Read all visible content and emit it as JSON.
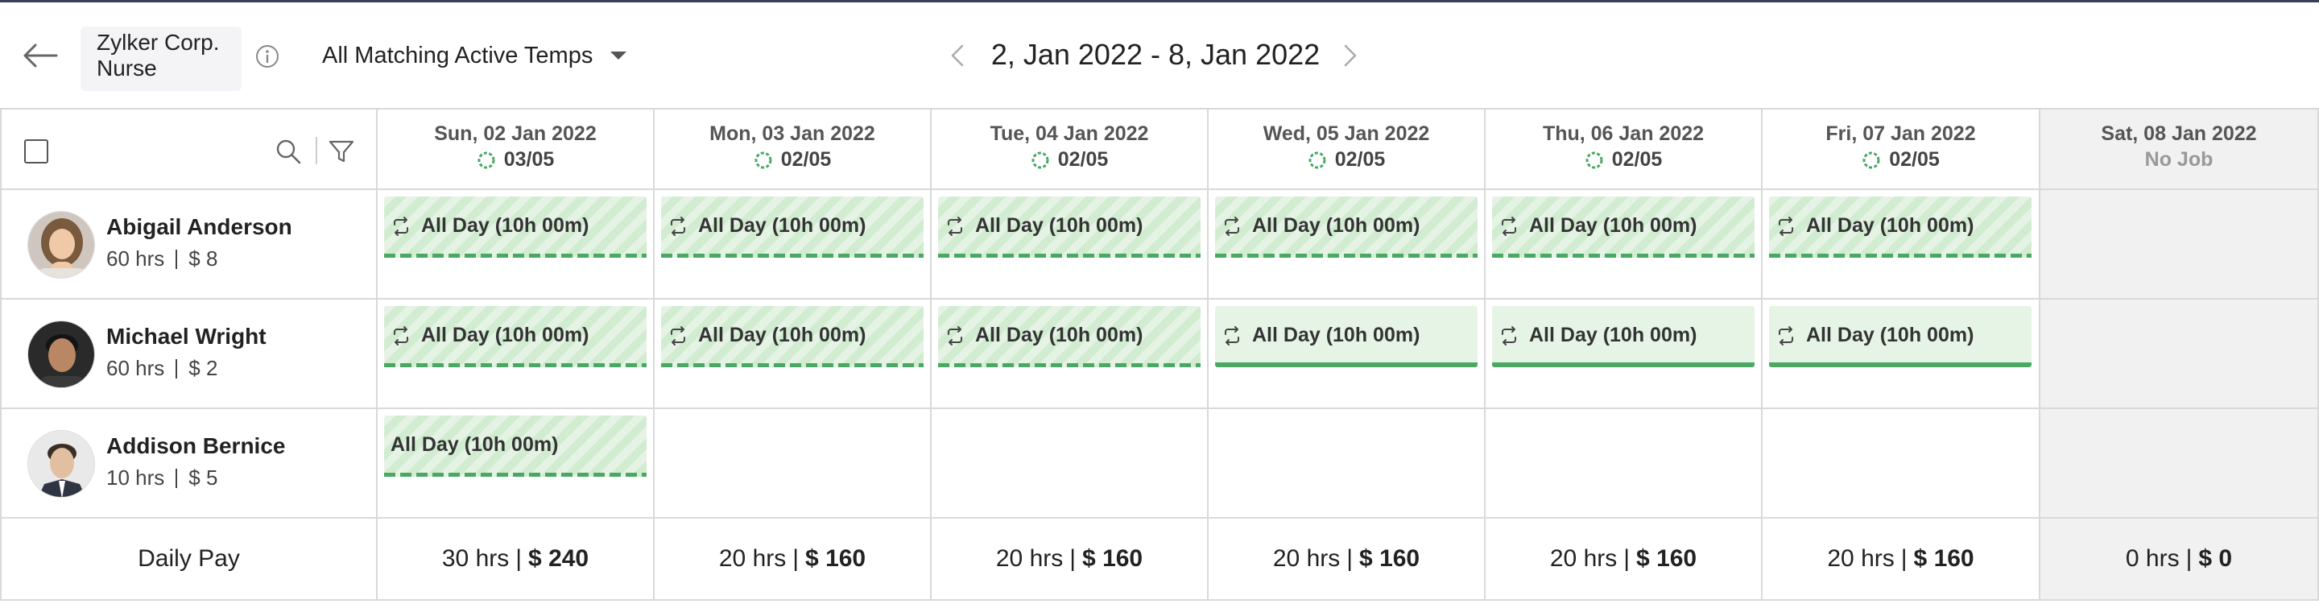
{
  "header": {
    "company": "Zylker Corp.",
    "role": "Nurse",
    "filter": "All Matching Active Temps",
    "date_range": "2, Jan 2022 - 8, Jan 2022"
  },
  "days": [
    {
      "title": "Sun, 02 Jan 2022",
      "count": "03/05"
    },
    {
      "title": "Mon, 03 Jan 2022",
      "count": "02/05"
    },
    {
      "title": "Tue, 04 Jan 2022",
      "count": "02/05"
    },
    {
      "title": "Wed, 05 Jan 2022",
      "count": "02/05"
    },
    {
      "title": "Thu, 06 Jan 2022",
      "count": "02/05"
    },
    {
      "title": "Fri, 07 Jan 2022",
      "count": "02/05"
    },
    {
      "title": "Sat, 08 Jan 2022",
      "count": "No Job"
    }
  ],
  "employees": [
    {
      "name": "Abigail Anderson",
      "hours": "60 hrs",
      "rate": "$ 8",
      "shift_label": "All Day (10h 00m)"
    },
    {
      "name": "Michael Wright",
      "hours": "60 hrs",
      "rate": "$ 2",
      "shift_label": "All Day (10h 00m)"
    },
    {
      "name": "Addison Bernice",
      "hours": "10 hrs",
      "rate": "$ 5",
      "shift_label": "All Day (10h 00m)"
    }
  ],
  "footer": {
    "label": "Daily Pay",
    "totals": [
      {
        "hours": "30 hrs",
        "pay": "$ 240"
      },
      {
        "hours": "20 hrs",
        "pay": "$ 160"
      },
      {
        "hours": "20 hrs",
        "pay": "$ 160"
      },
      {
        "hours": "20 hrs",
        "pay": "$ 160"
      },
      {
        "hours": "20 hrs",
        "pay": "$ 160"
      },
      {
        "hours": "20 hrs",
        "pay": "$ 160"
      },
      {
        "hours": "0 hrs",
        "pay": "$ 0"
      }
    ]
  },
  "colors": {
    "accent_green": "#4aa864",
    "shift_bg": "#e4f3e4",
    "no_job_bg": "#f1f1f1",
    "border": "#d9d9d9"
  },
  "icons": [
    "back-arrow-icon",
    "info-icon",
    "chevron-down-icon",
    "chevron-left-icon",
    "chevron-right-icon",
    "search-icon",
    "filter-icon",
    "progress-ring-icon",
    "repeat-icon"
  ]
}
